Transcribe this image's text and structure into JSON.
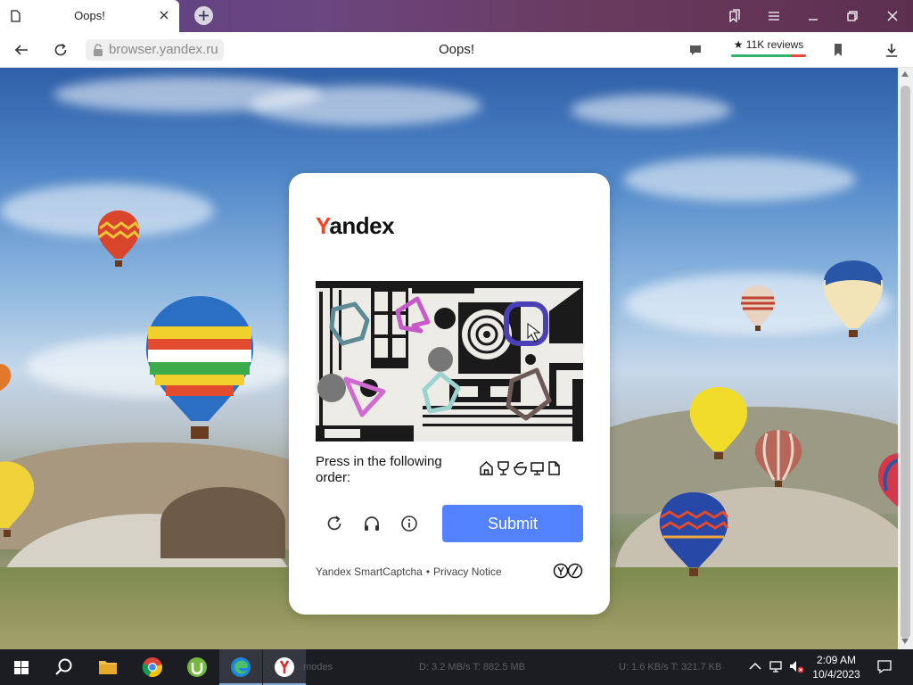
{
  "window": {
    "tab_title": "Oops!",
    "icons": {
      "tab": "page-icon",
      "close": "close-icon",
      "new_tab": "plus-icon",
      "collections": "bookmarks-collection-icon",
      "menu": "hamburger-menu-icon",
      "minimize": "minimize-icon",
      "restore": "restore-icon",
      "close_window": "close-icon"
    }
  },
  "addressbar": {
    "url": "browser.yandex.ru",
    "page_title": "Oops!",
    "reviews_label": "★ 11K reviews",
    "reviews_positive_fraction": 0.8,
    "icons": {
      "back": "arrow-left-icon",
      "reload": "reload-icon",
      "lock": "lock-icon",
      "chat": "chat-icon",
      "bookmark": "bookmark-icon",
      "download": "download-icon"
    }
  },
  "captcha": {
    "logo_first": "Y",
    "logo_rest": "andex",
    "instruction": "Press in the following order:",
    "order_icons": [
      "house-icon",
      "trophy-icon",
      "bowl-icon",
      "monitor-icon",
      "document-icon"
    ],
    "tools": [
      "reload-icon",
      "headphones-icon",
      "info-icon"
    ],
    "submit_label": "Submit",
    "footer_product": "Yandex SmartCaptcha",
    "footer_separator": "•",
    "footer_privacy": "Privacy Notice",
    "brand_color": "#5282ff"
  },
  "taskbar": {
    "apps": [
      "windows-start-icon",
      "search-icon",
      "file-explorer-icon",
      "chrome-icon",
      "utorrent-icon",
      "edge-icon",
      "yandex-browser-icon"
    ],
    "status_modes": "modes",
    "status_download": "D: 3.2 MB/s T: 882.5 MB",
    "status_upload": "U: 1.6 KB/s T: 321.7 KB",
    "tray_icons": [
      "chevron-up-icon",
      "network-icon",
      "volume-muted-icon",
      "notification-icon"
    ],
    "time": "2:09 AM",
    "date": "10/4/2023"
  }
}
